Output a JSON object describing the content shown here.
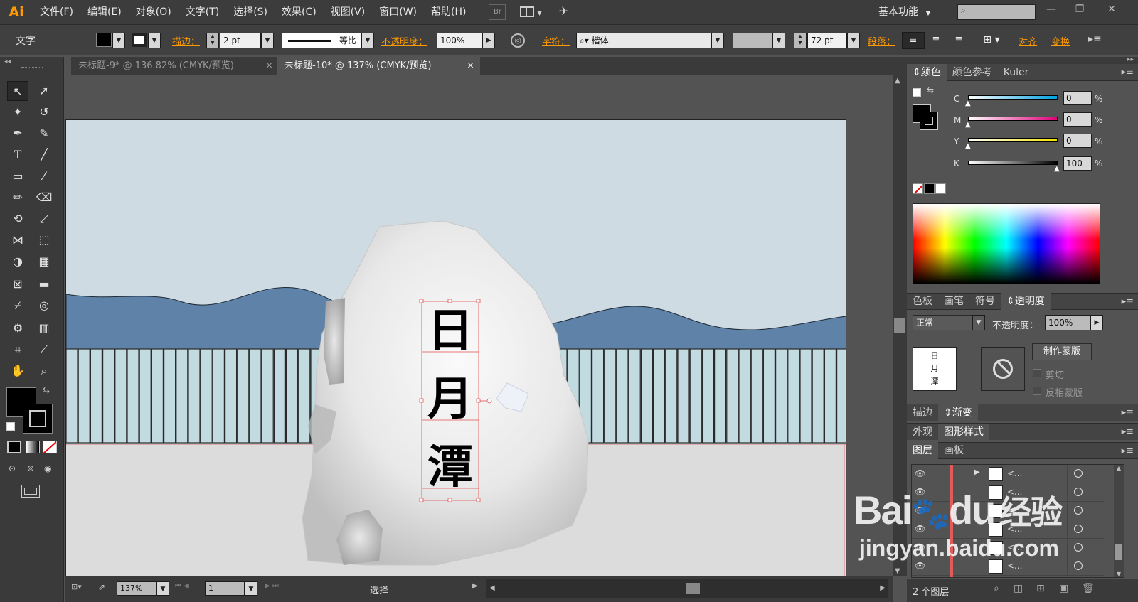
{
  "menubar": {
    "logo": "Ai",
    "items": [
      "文件(F)",
      "编辑(E)",
      "对象(O)",
      "文字(T)",
      "选择(S)",
      "效果(C)",
      "视图(V)",
      "窗口(W)",
      "帮助(H)"
    ],
    "bridge": "Br",
    "workspace": "基本功能",
    "search_placeholder": ""
  },
  "control": {
    "tool_name": "文字",
    "stroke_label": "描边：",
    "stroke_value": "2 pt",
    "stroke_profile": "等比",
    "opacity_label": "不透明度：",
    "opacity_value": "100%",
    "char_label": "字符：",
    "font_name": "楷体",
    "font_style": "-",
    "font_size": "72 pt",
    "para_label": "段落：",
    "align_label": "对齐",
    "transform_label": "变换"
  },
  "tabs": [
    {
      "label": "未标题-9* @ 136.82% (CMYK/预览)",
      "close": "×",
      "active": false
    },
    {
      "label": "未标题-10* @ 137% (CMYK/预览)",
      "close": "×",
      "active": true
    }
  ],
  "artwork": {
    "text_chars": [
      "日",
      "月",
      "潭"
    ],
    "sky_color": "#cfdbe2",
    "mountain_color": "#5e82a8",
    "fence_color": "#c1dbe1",
    "ground_color": "#dcdcdc"
  },
  "color_panel": {
    "tabs": [
      "颜色",
      "颜色参考",
      "Kuler"
    ],
    "channels": [
      {
        "name": "C",
        "value": "0"
      },
      {
        "name": "M",
        "value": "0"
      },
      {
        "name": "Y",
        "value": "0"
      },
      {
        "name": "K",
        "value": "100"
      }
    ],
    "percent": "%"
  },
  "transparency_panel": {
    "tabs": [
      "色板",
      "画笔",
      "符号",
      "透明度"
    ],
    "blend_mode": "正常",
    "opacity_label": "不透明度：",
    "opacity_value": "100%",
    "thumb_text": [
      "日",
      "月",
      "潭"
    ],
    "make_mask": "制作蒙版",
    "clip": "剪切",
    "invert_mask": "反相蒙版"
  },
  "stroke_gradient_tabs": [
    "描边",
    "渐变"
  ],
  "appearance_tabs": [
    "外观",
    "图形样式"
  ],
  "layers_panel": {
    "tabs": [
      "图层",
      "画板"
    ],
    "rows": [
      {
        "name": "<..."
      },
      {
        "name": "<..."
      },
      {
        "name": "<..."
      },
      {
        "name": "<..."
      },
      {
        "name": "<..."
      },
      {
        "name": "<..."
      }
    ],
    "footer": "2 个图层"
  },
  "status": {
    "zoom": "137%",
    "page": "1",
    "tool": "选择"
  },
  "watermark": {
    "brand": "Bai",
    "paw": "🐾",
    "du": "du",
    "jy": "经验",
    "url": "jingyan.baidu.com"
  }
}
